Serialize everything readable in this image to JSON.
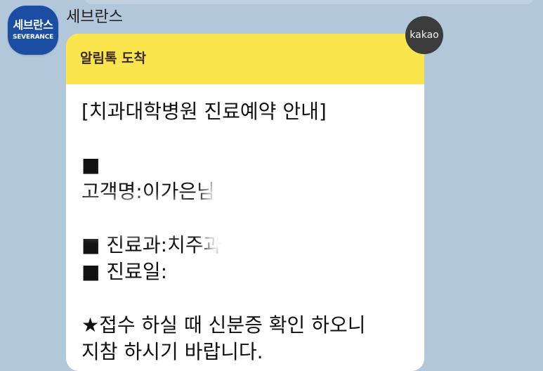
{
  "sender": {
    "name": "세브란스",
    "avatar_text_kor": "세브란스",
    "avatar_text_eng": "SEVERANCE"
  },
  "badge": {
    "label": "kakao"
  },
  "message": {
    "header": "알림톡 도착",
    "lines": {
      "title": "[치과대학병원 진료예약 안내]",
      "bullet1": "■",
      "patient": "고객명:이가은님",
      "department": "■ 진료과:치주과",
      "date": "■ 진료일:",
      "notice1": "★접수 하실 때 신분증 확인 하오니",
      "notice2": "지참 하시기 바랍니다."
    }
  },
  "colors": {
    "background": "#b2c7da",
    "header_yellow": "#fae64c",
    "avatar_blue": "#1b4ea3",
    "badge_dark": "#3c3c3c"
  }
}
